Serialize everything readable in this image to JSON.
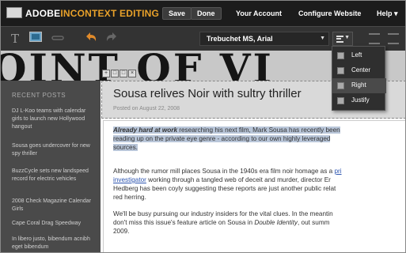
{
  "brand": {
    "part1": "ADOBE",
    "part2": "INCONTEXT EDITING"
  },
  "top_buttons": {
    "save": "Save",
    "done": "Done"
  },
  "top_nav": {
    "account": "Your Account",
    "configure": "Configure Website",
    "help": "Help ▾"
  },
  "toolbar": {
    "font": "Trebuchet MS, Arial",
    "text_tool": "T"
  },
  "masthead": "OINT OF VI",
  "sidebar": {
    "title": "RECENT POSTS",
    "items": [
      "DJ L-Koo teams with calendar girls to launch new Hollywood hangout",
      "Sousa goes undercover for new spy thriller",
      "BuzzCycle sets new landspeed record for electric vehicles",
      "2008 Check Magazine Calendar Girls",
      "Cape Coral Drag Speedway",
      "In libero justo, bibendum acnibh eget bibendum"
    ]
  },
  "post": {
    "title": "Sousa relives Noir with sultry thriller",
    "meta": "Posted on August 22, 2008",
    "p1_bold": "Already hard at work",
    "p1_l1": " researching his next film, Mark Sousa has recently been",
    "p1_l2": "reading up on the private eye genre - according to our own highly leveraged",
    "p1_l3": "sources.",
    "p2_l1a": "Although the rumor mill places Sousa in the 1940s era film noir homage as a ",
    "p2_l1b": "pri",
    "p2_l2a": "investigator",
    "p2_l2b": " working through a tangled web of deceit and murder, director Er",
    "p2_l3": "Hedberg has been coyly suggesting these reports are just another public relat",
    "p2_l4": "red herring.",
    "p3_l1": "We'll be busy pursuing our industry insiders for the vital clues. In the meantin",
    "p3_l2a": "don't miss this issue's feature article on Sousa in ",
    "p3_l2b": "Double Identity",
    "p3_l2c": ", out summ",
    "p3_l3": "2009."
  },
  "align_menu": {
    "items": [
      "Left",
      "Center",
      "Right",
      "Justify"
    ],
    "selected": "Right"
  },
  "colors": {
    "accent": "#e8a12a",
    "highlight": "#b9c6d9",
    "link": "#2d55b0"
  }
}
